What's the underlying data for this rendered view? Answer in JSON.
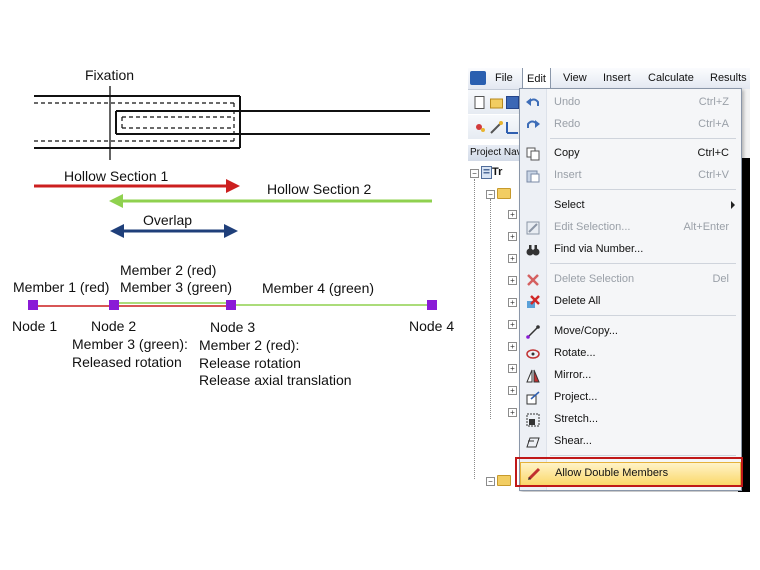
{
  "diagram": {
    "fixation_label": "Fixation",
    "hollow_section_1": "Hollow Section 1",
    "hollow_section_2": "Hollow Section 2",
    "overlap": "Overlap",
    "member_1": "Member 1 (red)",
    "member_2_red": "Member 2 (red)",
    "member_3_green": "Member 3 (green)",
    "member_4": "Member 4 (green)",
    "node_1": "Node 1",
    "node_2": "Node 2",
    "node_3": "Node 3",
    "node_4": "Node 4",
    "node2_note_line1": "Member 3 (green):",
    "node2_note_line2": "Released rotation",
    "node3_note_line1": "Member 2 (red):",
    "node3_note_line2": "Release rotation",
    "node3_note_line3": "Release axial translation",
    "colors": {
      "red": "#cc1f1f",
      "green": "#8fd14f",
      "blue": "#1f3f7a",
      "node": "#8a1bd6"
    }
  },
  "app": {
    "menubar": {
      "file": "File",
      "edit": "Edit",
      "view": "View",
      "insert": "Insert",
      "calculate": "Calculate",
      "results": "Results"
    },
    "navigator_header": "Project Navigator",
    "tree_root": "Tr",
    "edit_menu": {
      "items": [
        {
          "label": "Undo",
          "shortcut": "Ctrl+Z",
          "icon": "undo-icon"
        },
        {
          "label": "Redo",
          "shortcut": "Ctrl+A",
          "icon": "redo-icon"
        },
        {
          "label": "Copy",
          "shortcut": "Ctrl+C",
          "icon": "copy-icon"
        },
        {
          "label": "Insert",
          "shortcut": "Ctrl+V",
          "icon": "paste-icon"
        },
        {
          "label": "Select",
          "shortcut": "",
          "icon": ""
        },
        {
          "label": "Edit Selection...",
          "shortcut": "Alt+Enter",
          "icon": "edit-selection-icon"
        },
        {
          "label": "Find via Number...",
          "shortcut": "",
          "icon": "binoculars-icon"
        },
        {
          "label": "Delete Selection",
          "shortcut": "Del",
          "icon": "delete-icon"
        },
        {
          "label": "Delete All",
          "shortcut": "",
          "icon": "delete-all-icon"
        },
        {
          "label": "Move/Copy...",
          "shortcut": "",
          "icon": "move-copy-icon"
        },
        {
          "label": "Rotate...",
          "shortcut": "",
          "icon": "rotate-icon"
        },
        {
          "label": "Mirror...",
          "shortcut": "",
          "icon": "mirror-icon"
        },
        {
          "label": "Project...",
          "shortcut": "",
          "icon": "project-icon"
        },
        {
          "label": "Stretch...",
          "shortcut": "",
          "icon": "stretch-icon"
        },
        {
          "label": "Shear...",
          "shortcut": "",
          "icon": "shear-icon"
        },
        {
          "label": "Allow Double Members",
          "shortcut": "",
          "icon": "pencil-icon"
        }
      ]
    }
  }
}
